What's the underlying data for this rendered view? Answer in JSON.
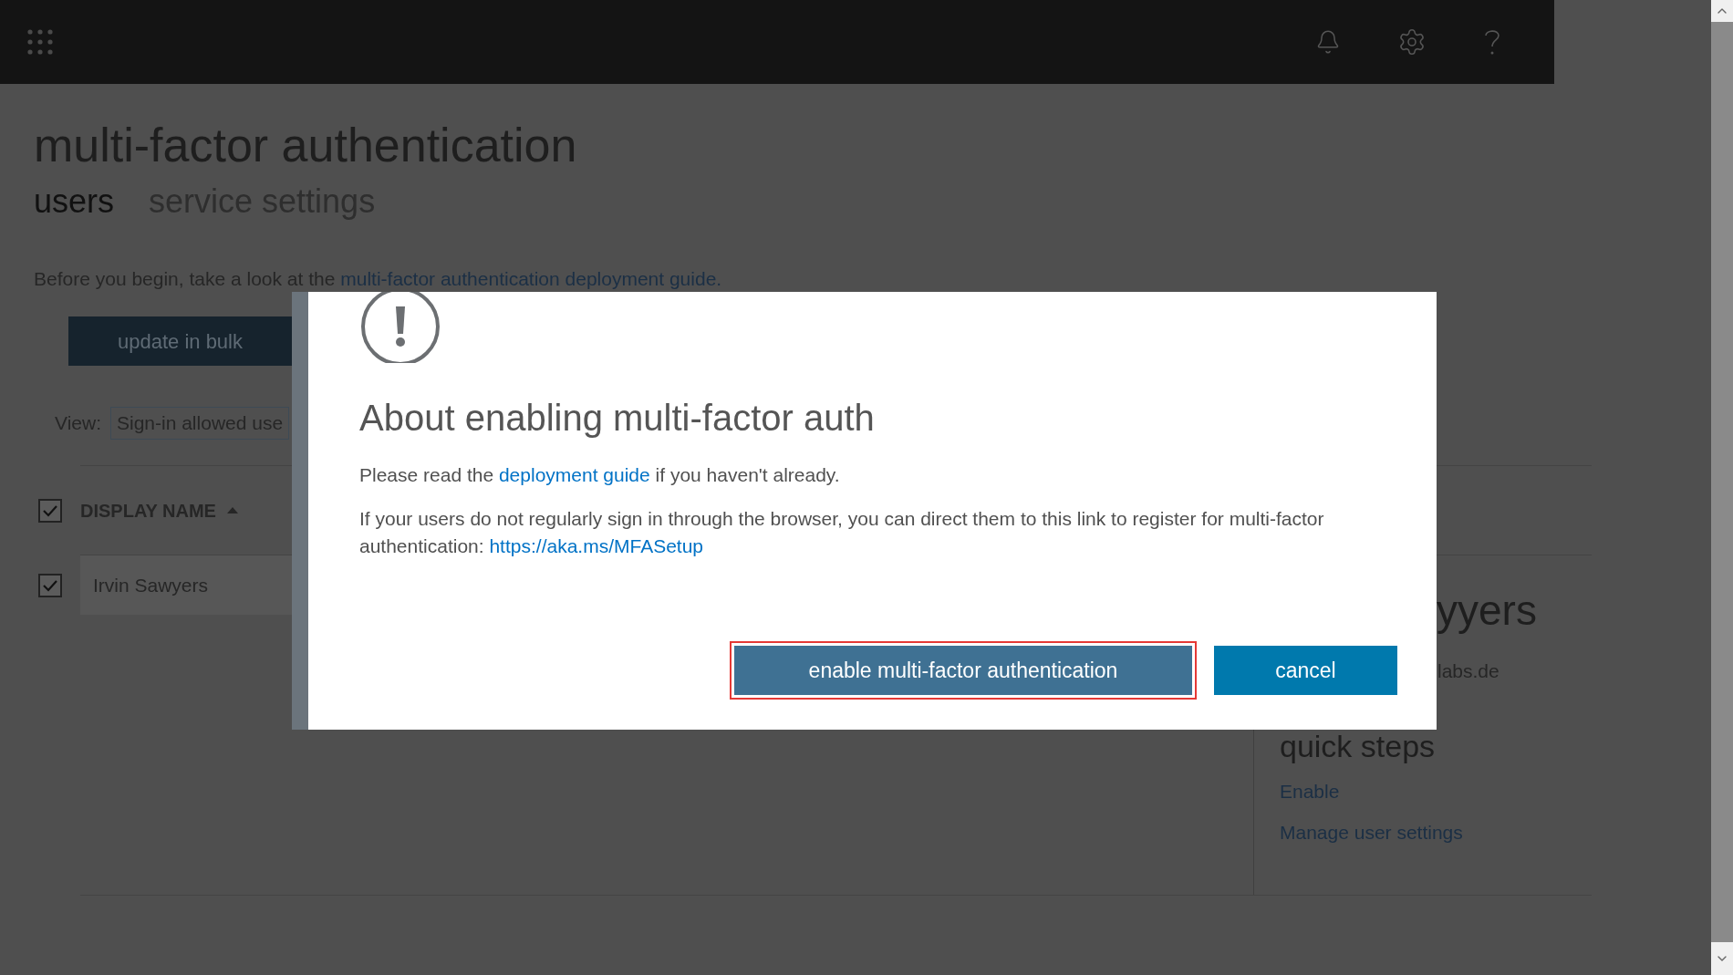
{
  "page": {
    "title": "multi-factor authentication",
    "tabs": [
      {
        "label": "users",
        "selected": true
      },
      {
        "label": "service settings",
        "selected": false
      }
    ],
    "intro": [
      {
        "kind": "text",
        "text": "Before you begin, take a look at the "
      },
      {
        "kind": "link",
        "text": "multi-factor authentication deployment guide."
      }
    ],
    "bulk_button": "update in bulk",
    "view": {
      "label": "View:",
      "value": "Sign-in allowed use"
    },
    "table": {
      "select_all_checked": true,
      "columns": [
        {
          "label": "DISPLAY NAME",
          "sorted_ascending": true
        }
      ],
      "rows": [
        {
          "name": "Irvin Sawyers",
          "checked": true
        }
      ]
    }
  },
  "detail_panel": {
    "name": "yyers",
    "email": "labs.de",
    "quick_steps": {
      "title": "quick steps",
      "links": [
        "Enable",
        "Manage user settings"
      ]
    }
  },
  "dialog": {
    "title": "About enabling multi-factor auth",
    "paragraphs": [
      [
        {
          "kind": "text",
          "text": "Please read the "
        },
        {
          "kind": "link",
          "text": "deployment guide"
        },
        {
          "kind": "text",
          "text": " if you haven't already."
        }
      ],
      [
        {
          "kind": "text",
          "text": "If your users do not regularly sign in through the browser, you can direct them to this link to register for multi-factor authentication: "
        },
        {
          "kind": "link",
          "text": "https://aka.ms/MFASetup"
        }
      ]
    ],
    "buttons": [
      {
        "label": "enable multi-factor authentication",
        "kind": "primary",
        "highlighted": true
      },
      {
        "label": "cancel",
        "kind": "secondary",
        "highlighted": false
      }
    ]
  }
}
